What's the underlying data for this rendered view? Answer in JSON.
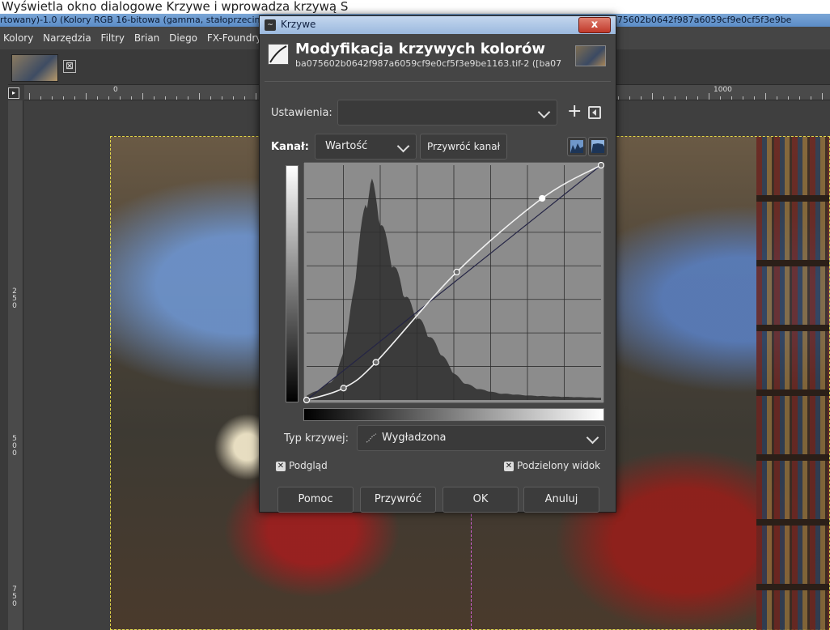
{
  "caption": "Wyświetla okno dialogowe Krzywe i wprowadza krzywą S",
  "gimp": {
    "title": "rtowany)-1.0 (Kolory RGB 16-bitowa (gamma, stałoprzecinkowa), RT_sRGB gamma sRGB(ICC61966 equivalent), 1 warstwa) 1200x805 ba075602b0642f987a6059cf9e0cf5f3e9be",
    "menu": [
      "Kolory",
      "Narzędzia",
      "Filtry",
      "Brian",
      "Diego",
      "FX-Foundry"
    ],
    "tab_close": "⊠",
    "ruler_labels": {
      "h0": "0",
      "h1000": "1000",
      "v250": "2 5 0",
      "v500": "5 0 0",
      "v750": "7 5 0"
    }
  },
  "dialog": {
    "title": "Krzywe",
    "close_label": "x",
    "header_title": "Modyfikacja krzywych kolorów",
    "header_subtitle": "ba075602b0642f987a6059cf9e0cf5f3e9be1163.tif-2 ([ba07...",
    "presets_label": "Ustawienia:",
    "presets_value": "",
    "presets_add": "+",
    "channel_label": "Kanał:",
    "channel_value": "Wartość",
    "reset_channel": "Przywróć kanał",
    "curve_type_label": "Typ krzywej:",
    "curve_type_value": "Wygładzona",
    "preview_label": "Podgląd",
    "preview_checked": true,
    "split_view_label": "Podzielony widok",
    "split_view_checked": true,
    "buttons": {
      "help": "Pomoc",
      "reset": "Przywróć",
      "ok": "OK",
      "cancel": "Anuluj"
    }
  },
  "curve": {
    "control_points": [
      [
        0,
        0
      ],
      [
        32,
        13
      ],
      [
        60,
        41
      ],
      [
        130,
        139
      ],
      [
        204,
        219
      ],
      [
        255,
        255
      ]
    ],
    "histogram_peaks": [
      {
        "pos": 0.0,
        "h": 0.02
      },
      {
        "pos": 0.05,
        "h": 0.05
      },
      {
        "pos": 0.1,
        "h": 0.1
      },
      {
        "pos": 0.14,
        "h": 0.3
      },
      {
        "pos": 0.17,
        "h": 0.6
      },
      {
        "pos": 0.2,
        "h": 0.88
      },
      {
        "pos": 0.22,
        "h": 0.96
      },
      {
        "pos": 0.24,
        "h": 0.86
      },
      {
        "pos": 0.27,
        "h": 0.7
      },
      {
        "pos": 0.3,
        "h": 0.58
      },
      {
        "pos": 0.33,
        "h": 0.48
      },
      {
        "pos": 0.36,
        "h": 0.4
      },
      {
        "pos": 0.39,
        "h": 0.34
      },
      {
        "pos": 0.42,
        "h": 0.28
      },
      {
        "pos": 0.45,
        "h": 0.22
      },
      {
        "pos": 0.48,
        "h": 0.16
      },
      {
        "pos": 0.5,
        "h": 0.12
      },
      {
        "pos": 0.53,
        "h": 0.08
      },
      {
        "pos": 0.58,
        "h": 0.05
      },
      {
        "pos": 0.65,
        "h": 0.03
      },
      {
        "pos": 0.75,
        "h": 0.02
      },
      {
        "pos": 0.85,
        "h": 0.015
      },
      {
        "pos": 1.0,
        "h": 0.01
      }
    ]
  },
  "icons": {
    "dialog_title_icon": "curves-icon",
    "header_icon": "curves-tool-icon",
    "presets_menu": "preset-menu-icon",
    "linear_hist": "linear-histogram-icon",
    "log_hist": "logarithmic-histogram-icon"
  }
}
